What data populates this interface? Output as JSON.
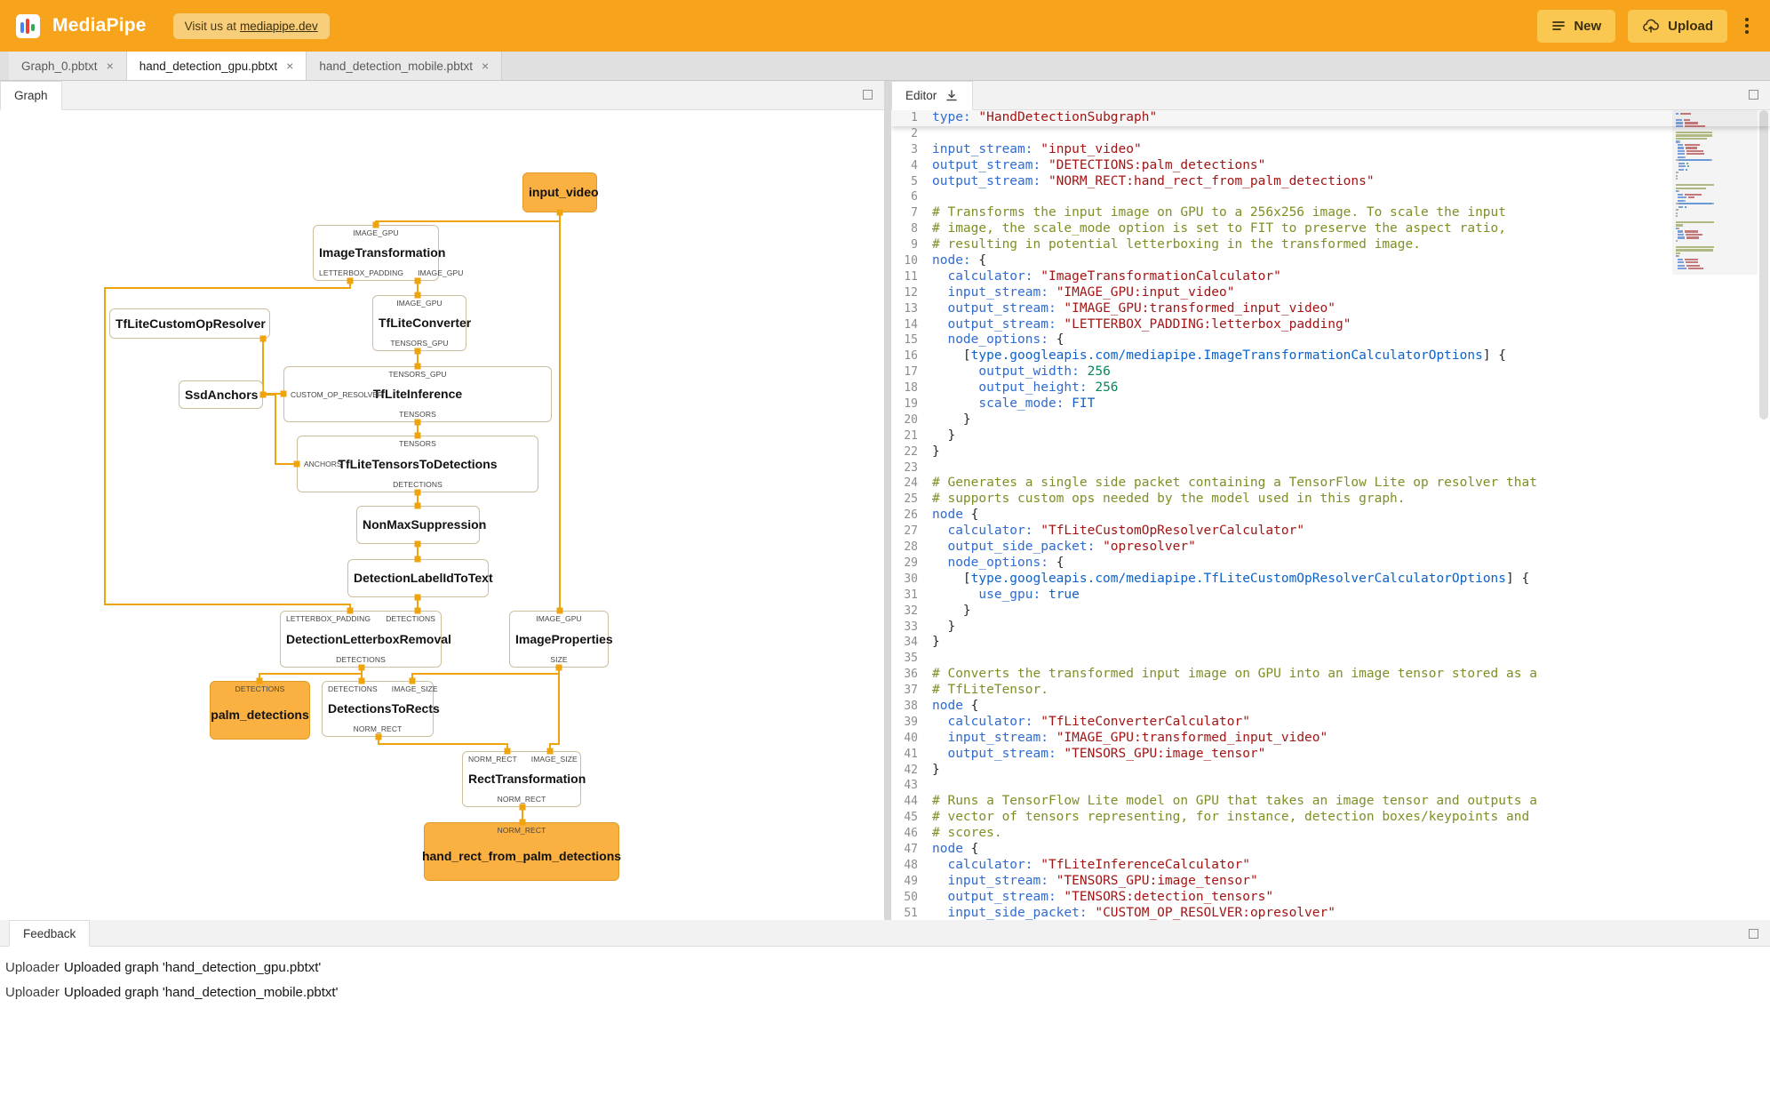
{
  "colors": {
    "header-bg": "#F7A41C",
    "btn-bg": "#FAC851",
    "badge-bg": "#F9CE7B",
    "edge": "#EFA40D",
    "stream-fill": "#FBB042",
    "stream-border": "#DF9B26",
    "node-border": "#CDBE9E",
    "tok-k": "#2F6BD0",
    "tok-s": "#A31515",
    "tok-n": "#098658",
    "tok-w": "#0D62C9",
    "tok-c": "#7E8F26",
    "tok-p": "#24292E",
    "logo-b1": "#4285F4",
    "logo-b2": "#EA4335",
    "logo-b3": "#34A853"
  },
  "header": {
    "title": "MediaPipe",
    "badge_prefix": "Visit us at",
    "badge_link": "mediapipe.dev",
    "new_label": "New",
    "upload_label": "Upload"
  },
  "tabs_meta": {
    "close_glyph": "×"
  },
  "tabs": [
    {
      "label": "Graph_0.pbtxt"
    },
    {
      "label": "hand_detection_gpu.pbtxt"
    },
    {
      "label": "hand_detection_mobile.pbtxt"
    }
  ],
  "graph_panel": {
    "tab_label": "Graph"
  },
  "editor_panel": {
    "tab_label": "Editor"
  },
  "feedback": {
    "tab_label": "Feedback",
    "rows": [
      {
        "source": "Uploader",
        "message": "Uploaded graph 'hand_detection_gpu.pbtxt'"
      },
      {
        "source": "Uploader",
        "message": "Uploaded graph 'hand_detection_mobile.pbtxt'"
      }
    ]
  },
  "graph": {
    "nodes": {
      "input_video": {
        "title": "input_video"
      },
      "image_transformation": {
        "title": "ImageTransformation",
        "in_ports": [
          "IMAGE_GPU"
        ],
        "out_ports": [
          "LETTERBOX_PADDING",
          "IMAGE_GPU"
        ]
      },
      "tflite_converter": {
        "title": "TfLiteConverter",
        "in_ports": [
          "IMAGE_GPU"
        ],
        "out_ports": [
          "TENSORS_GPU"
        ]
      },
      "tflite_custom_op_resolver": {
        "title": "TfLiteCustomOpResolver"
      },
      "ssd_anchors": {
        "title": "SsdAnchors"
      },
      "tflite_inference": {
        "title": "TfLiteInference",
        "in_ports": [
          "TENSORS_GPU"
        ],
        "side_port": "CUSTOM_OP_RESOLVER",
        "out_ports": [
          "TENSORS"
        ]
      },
      "tflite_tensors_to_detections": {
        "title": "TfLiteTensorsToDetections",
        "in_ports": [
          "TENSORS"
        ],
        "side_port": "ANCHORS",
        "out_ports": [
          "DETECTIONS"
        ]
      },
      "non_max_suppression": {
        "title": "NonMaxSuppression"
      },
      "detection_label_id_to_text": {
        "title": "DetectionLabelIdToText"
      },
      "detection_letterbox_removal": {
        "title": "DetectionLetterboxRemoval",
        "in_ports": [
          "LETTERBOX_PADDING",
          "DETECTIONS"
        ],
        "out_ports": [
          "DETECTIONS"
        ]
      },
      "image_properties": {
        "title": "ImageProperties",
        "in_ports": [
          "IMAGE_GPU"
        ],
        "out_ports": [
          "SIZE"
        ]
      },
      "palm_detections": {
        "title": "palm_detections",
        "in_ports": [
          "DETECTIONS"
        ]
      },
      "detections_to_rects": {
        "title": "DetectionsToRects",
        "in_ports": [
          "DETECTIONS",
          "IMAGE_SIZE"
        ],
        "out_ports": [
          "NORM_RECT"
        ]
      },
      "rect_transformation": {
        "title": "RectTransformation",
        "in_ports": [
          "NORM_RECT",
          "IMAGE_SIZE"
        ],
        "out_ports": [
          "NORM_RECT"
        ]
      },
      "hand_rect_from_palm_detections": {
        "title": "hand_rect_from_palm_detections",
        "in_ports": [
          "NORM_RECT"
        ]
      }
    }
  },
  "editor": {
    "lines": [
      [
        [
          "k",
          "type:"
        ],
        [
          "p",
          " "
        ],
        [
          "s",
          "\"HandDetectionSubgraph\""
        ]
      ],
      [],
      [
        [
          "k",
          "input_stream:"
        ],
        [
          "p",
          " "
        ],
        [
          "s",
          "\"input_video\""
        ]
      ],
      [
        [
          "k",
          "output_stream:"
        ],
        [
          "p",
          " "
        ],
        [
          "s",
          "\"DETECTIONS:palm_detections\""
        ]
      ],
      [
        [
          "k",
          "output_stream:"
        ],
        [
          "p",
          " "
        ],
        [
          "s",
          "\"NORM_RECT:hand_rect_from_palm_detections\""
        ]
      ],
      [],
      [
        [
          "c",
          "# Transforms the input image on GPU to a 256x256 image. To scale the input"
        ]
      ],
      [
        [
          "c",
          "# image, the scale_mode option is set to FIT to preserve the aspect ratio,"
        ]
      ],
      [
        [
          "c",
          "# resulting in potential letterboxing in the transformed image."
        ]
      ],
      [
        [
          "k",
          "node:"
        ],
        [
          "p",
          " {"
        ]
      ],
      [
        [
          "p",
          "  "
        ],
        [
          "k",
          "calculator:"
        ],
        [
          "p",
          " "
        ],
        [
          "s",
          "\"ImageTransformationCalculator\""
        ]
      ],
      [
        [
          "p",
          "  "
        ],
        [
          "k",
          "input_stream:"
        ],
        [
          "p",
          " "
        ],
        [
          "s",
          "\"IMAGE_GPU:input_video\""
        ]
      ],
      [
        [
          "p",
          "  "
        ],
        [
          "k",
          "output_stream:"
        ],
        [
          "p",
          " "
        ],
        [
          "s",
          "\"IMAGE_GPU:transformed_input_video\""
        ]
      ],
      [
        [
          "p",
          "  "
        ],
        [
          "k",
          "output_stream:"
        ],
        [
          "p",
          " "
        ],
        [
          "s",
          "\"LETTERBOX_PADDING:letterbox_padding\""
        ]
      ],
      [
        [
          "p",
          "  "
        ],
        [
          "k",
          "node_options:"
        ],
        [
          "p",
          " {"
        ]
      ],
      [
        [
          "p",
          "    ["
        ],
        [
          "w",
          "type.googleapis.com/mediapipe.ImageTransformationCalculatorOptions"
        ],
        [
          "p",
          "] {"
        ]
      ],
      [
        [
          "p",
          "      "
        ],
        [
          "k",
          "output_width:"
        ],
        [
          "p",
          " "
        ],
        [
          "n",
          "256"
        ]
      ],
      [
        [
          "p",
          "      "
        ],
        [
          "k",
          "output_height:"
        ],
        [
          "p",
          " "
        ],
        [
          "n",
          "256"
        ]
      ],
      [
        [
          "p",
          "      "
        ],
        [
          "k",
          "scale_mode:"
        ],
        [
          "p",
          " "
        ],
        [
          "w",
          "FIT"
        ]
      ],
      [
        [
          "p",
          "    }"
        ]
      ],
      [
        [
          "p",
          "  }"
        ]
      ],
      [
        [
          "p",
          "}"
        ]
      ],
      [],
      [
        [
          "c",
          "# Generates a single side packet containing a TensorFlow Lite op resolver that"
        ]
      ],
      [
        [
          "c",
          "# supports custom ops needed by the model used in this graph."
        ]
      ],
      [
        [
          "k",
          "node"
        ],
        [
          "p",
          " {"
        ]
      ],
      [
        [
          "p",
          "  "
        ],
        [
          "k",
          "calculator:"
        ],
        [
          "p",
          " "
        ],
        [
          "s",
          "\"TfLiteCustomOpResolverCalculator\""
        ]
      ],
      [
        [
          "p",
          "  "
        ],
        [
          "k",
          "output_side_packet:"
        ],
        [
          "p",
          " "
        ],
        [
          "s",
          "\"opresolver\""
        ]
      ],
      [
        [
          "p",
          "  "
        ],
        [
          "k",
          "node_options:"
        ],
        [
          "p",
          " {"
        ]
      ],
      [
        [
          "p",
          "    ["
        ],
        [
          "w",
          "type.googleapis.com/mediapipe.TfLiteCustomOpResolverCalculatorOptions"
        ],
        [
          "p",
          "] {"
        ]
      ],
      [
        [
          "p",
          "      "
        ],
        [
          "k",
          "use_gpu:"
        ],
        [
          "p",
          " "
        ],
        [
          "w",
          "true"
        ]
      ],
      [
        [
          "p",
          "    }"
        ]
      ],
      [
        [
          "p",
          "  }"
        ]
      ],
      [
        [
          "p",
          "}"
        ]
      ],
      [],
      [
        [
          "c",
          "# Converts the transformed input image on GPU into an image tensor stored as a"
        ]
      ],
      [
        [
          "c",
          "# TfLiteTensor."
        ]
      ],
      [
        [
          "k",
          "node"
        ],
        [
          "p",
          " {"
        ]
      ],
      [
        [
          "p",
          "  "
        ],
        [
          "k",
          "calculator:"
        ],
        [
          "p",
          " "
        ],
        [
          "s",
          "\"TfLiteConverterCalculator\""
        ]
      ],
      [
        [
          "p",
          "  "
        ],
        [
          "k",
          "input_stream:"
        ],
        [
          "p",
          " "
        ],
        [
          "s",
          "\"IMAGE_GPU:transformed_input_video\""
        ]
      ],
      [
        [
          "p",
          "  "
        ],
        [
          "k",
          "output_stream:"
        ],
        [
          "p",
          " "
        ],
        [
          "s",
          "\"TENSORS_GPU:image_tensor\""
        ]
      ],
      [
        [
          "p",
          "}"
        ]
      ],
      [],
      [
        [
          "c",
          "# Runs a TensorFlow Lite model on GPU that takes an image tensor and outputs a"
        ]
      ],
      [
        [
          "c",
          "# vector of tensors representing, for instance, detection boxes/keypoints and"
        ]
      ],
      [
        [
          "c",
          "# scores."
        ]
      ],
      [
        [
          "k",
          "node"
        ],
        [
          "p",
          " {"
        ]
      ],
      [
        [
          "p",
          "  "
        ],
        [
          "k",
          "calculator:"
        ],
        [
          "p",
          " "
        ],
        [
          "s",
          "\"TfLiteInferenceCalculator\""
        ]
      ],
      [
        [
          "p",
          "  "
        ],
        [
          "k",
          "input_stream:"
        ],
        [
          "p",
          " "
        ],
        [
          "s",
          "\"TENSORS_GPU:image_tensor\""
        ]
      ],
      [
        [
          "p",
          "  "
        ],
        [
          "k",
          "output_stream:"
        ],
        [
          "p",
          " "
        ],
        [
          "s",
          "\"TENSORS:detection_tensors\""
        ]
      ],
      [
        [
          "p",
          "  "
        ],
        [
          "k",
          "input_side_packet:"
        ],
        [
          "p",
          " "
        ],
        [
          "s",
          "\"CUSTOM_OP_RESOLVER:opresolver\""
        ]
      ]
    ]
  }
}
